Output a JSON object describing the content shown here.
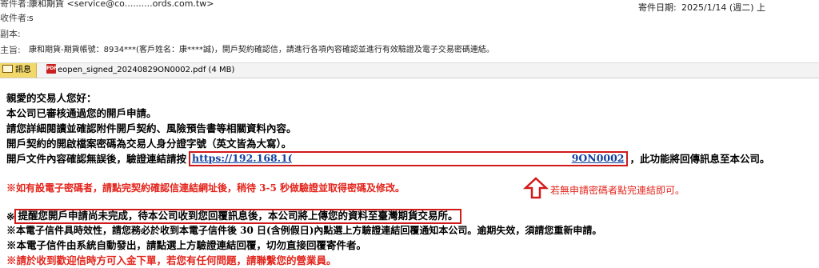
{
  "header": {
    "from_label": "寄件者:",
    "from_value": "康和期貨 <service@co..........ords.com.tw>",
    "to_label": "收件者:",
    "to_value": "s",
    "cc_label": "副本:",
    "cc_value": "",
    "subject_label": "主旨:",
    "subject_value": "康和期貨-期貨帳號：8934***(客戶姓名：康****誠)，開戶契約確認信，請進行各項內容確認並進行有效驗證及電子交易密碼連結。",
    "sent_label": "寄件日期:",
    "sent_value": "2025/1/14 (週二) 上"
  },
  "attachments": {
    "message_tab": "訊息",
    "file_name": "eopen_signed_20240829ON0002.pdf (4 MB)",
    "file_icon": "pdf-icon"
  },
  "body": {
    "greeting": "親愛的交易人您好：",
    "line1": "本公司已審核通過您的開戶申請。",
    "line2": "請您詳細閱讀並確認附件開戶契約、風險預告書等相關資料內容。",
    "line3": "開戶契約的開啟檔案密碼為交易人身分證字號（英文皆為大寫）。",
    "line4_prefix": "開戶文件內容確認無誤後，驗證連結請按",
    "link_start": "https://192.168.1(",
    "link_end": "9ON0002",
    "line4_suffix": "，此功能將回傳訊息至本公司。",
    "red_note": "※如有設電子密碼者，請點完契約確認信連結網址後，稍待 3-5 秒做驗證並取得密碼及修改。",
    "hint": "若無申請密碼者點完連結即可。",
    "remind_prefix": "※",
    "remind_boxed": "提醒您開戶申請尚未完成，待本公司收到您回覆訊息後，本公司將上傳您的資料至臺灣期貨交易所。",
    "note2": "※本電子信件具時效性，請您務必於收到本電子信件後 30 日(含例假日)內點選上方驗證連結回覆通知本公司。逾期失效，須請您重新申請。",
    "note3": "※本電子信件由系統自動發出，請點選上方驗證連結回覆，切勿直接回覆寄件者。",
    "note4": "※請於收到歡迎信時方可入金下單，若您有任何問題，請聯繫您的營業員。"
  },
  "colors": {
    "annotation_red": "#d21a1a",
    "link_blue": "#1040a0",
    "note_red": "#e3241b",
    "tab_yellow": "#f2d86b"
  }
}
